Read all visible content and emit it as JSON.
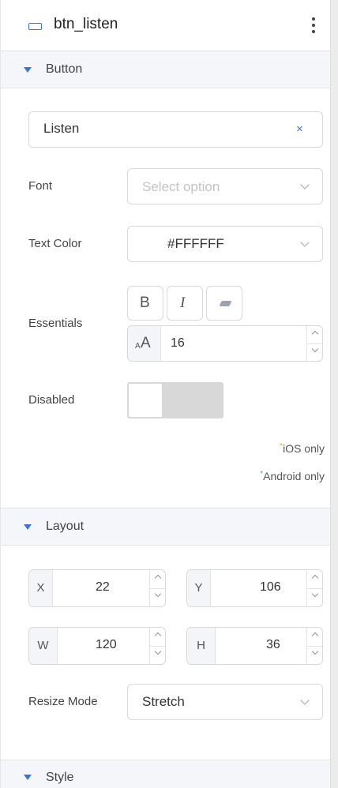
{
  "header": {
    "title": "btn_listen",
    "icon": "button-icon",
    "menu_icon": "kebab-menu-icon"
  },
  "sections": {
    "button": {
      "label": "Button"
    },
    "layout": {
      "label": "Layout"
    },
    "style": {
      "label": "Style"
    }
  },
  "button": {
    "text_value": "Listen",
    "clear_glyph": "×",
    "font": {
      "label": "Font",
      "placeholder": "Select option"
    },
    "text_color": {
      "label": "Text Color",
      "value": "#FFFFFF"
    },
    "essentials": {
      "label": "Essentials",
      "bold_glyph": "B",
      "italic_glyph": "I",
      "size_prefix_small": "A",
      "size_prefix_big": "A",
      "font_size": "16"
    },
    "disabled": {
      "label": "Disabled",
      "on": false
    },
    "note_ios": "iOS only",
    "note_android": "Android only",
    "ios_marker_color": "#f5a623",
    "android_marker_color": "#2ecc71"
  },
  "layout": {
    "x": {
      "label": "X",
      "value": "22"
    },
    "y": {
      "label": "Y",
      "value": "106"
    },
    "w": {
      "label": "W",
      "value": "120"
    },
    "h": {
      "label": "H",
      "value": "36"
    },
    "resize": {
      "label": "Resize Mode",
      "value": "Stretch"
    }
  },
  "colors": {
    "accent": "#3a73e0"
  }
}
